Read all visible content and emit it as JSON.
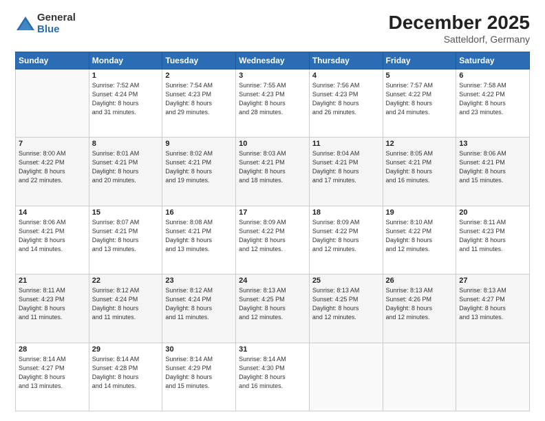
{
  "logo": {
    "general": "General",
    "blue": "Blue"
  },
  "header": {
    "month": "December 2025",
    "location": "Satteldorf, Germany"
  },
  "days_of_week": [
    "Sunday",
    "Monday",
    "Tuesday",
    "Wednesday",
    "Thursday",
    "Friday",
    "Saturday"
  ],
  "weeks": [
    [
      {
        "day": "",
        "info": ""
      },
      {
        "day": "1",
        "info": "Sunrise: 7:52 AM\nSunset: 4:24 PM\nDaylight: 8 hours\nand 31 minutes."
      },
      {
        "day": "2",
        "info": "Sunrise: 7:54 AM\nSunset: 4:23 PM\nDaylight: 8 hours\nand 29 minutes."
      },
      {
        "day": "3",
        "info": "Sunrise: 7:55 AM\nSunset: 4:23 PM\nDaylight: 8 hours\nand 28 minutes."
      },
      {
        "day": "4",
        "info": "Sunrise: 7:56 AM\nSunset: 4:23 PM\nDaylight: 8 hours\nand 26 minutes."
      },
      {
        "day": "5",
        "info": "Sunrise: 7:57 AM\nSunset: 4:22 PM\nDaylight: 8 hours\nand 24 minutes."
      },
      {
        "day": "6",
        "info": "Sunrise: 7:58 AM\nSunset: 4:22 PM\nDaylight: 8 hours\nand 23 minutes."
      }
    ],
    [
      {
        "day": "7",
        "info": "Sunrise: 8:00 AM\nSunset: 4:22 PM\nDaylight: 8 hours\nand 22 minutes."
      },
      {
        "day": "8",
        "info": "Sunrise: 8:01 AM\nSunset: 4:21 PM\nDaylight: 8 hours\nand 20 minutes."
      },
      {
        "day": "9",
        "info": "Sunrise: 8:02 AM\nSunset: 4:21 PM\nDaylight: 8 hours\nand 19 minutes."
      },
      {
        "day": "10",
        "info": "Sunrise: 8:03 AM\nSunset: 4:21 PM\nDaylight: 8 hours\nand 18 minutes."
      },
      {
        "day": "11",
        "info": "Sunrise: 8:04 AM\nSunset: 4:21 PM\nDaylight: 8 hours\nand 17 minutes."
      },
      {
        "day": "12",
        "info": "Sunrise: 8:05 AM\nSunset: 4:21 PM\nDaylight: 8 hours\nand 16 minutes."
      },
      {
        "day": "13",
        "info": "Sunrise: 8:06 AM\nSunset: 4:21 PM\nDaylight: 8 hours\nand 15 minutes."
      }
    ],
    [
      {
        "day": "14",
        "info": "Sunrise: 8:06 AM\nSunset: 4:21 PM\nDaylight: 8 hours\nand 14 minutes."
      },
      {
        "day": "15",
        "info": "Sunrise: 8:07 AM\nSunset: 4:21 PM\nDaylight: 8 hours\nand 13 minutes."
      },
      {
        "day": "16",
        "info": "Sunrise: 8:08 AM\nSunset: 4:21 PM\nDaylight: 8 hours\nand 13 minutes."
      },
      {
        "day": "17",
        "info": "Sunrise: 8:09 AM\nSunset: 4:22 PM\nDaylight: 8 hours\nand 12 minutes."
      },
      {
        "day": "18",
        "info": "Sunrise: 8:09 AM\nSunset: 4:22 PM\nDaylight: 8 hours\nand 12 minutes."
      },
      {
        "day": "19",
        "info": "Sunrise: 8:10 AM\nSunset: 4:22 PM\nDaylight: 8 hours\nand 12 minutes."
      },
      {
        "day": "20",
        "info": "Sunrise: 8:11 AM\nSunset: 4:23 PM\nDaylight: 8 hours\nand 11 minutes."
      }
    ],
    [
      {
        "day": "21",
        "info": "Sunrise: 8:11 AM\nSunset: 4:23 PM\nDaylight: 8 hours\nand 11 minutes."
      },
      {
        "day": "22",
        "info": "Sunrise: 8:12 AM\nSunset: 4:24 PM\nDaylight: 8 hours\nand 11 minutes."
      },
      {
        "day": "23",
        "info": "Sunrise: 8:12 AM\nSunset: 4:24 PM\nDaylight: 8 hours\nand 11 minutes."
      },
      {
        "day": "24",
        "info": "Sunrise: 8:13 AM\nSunset: 4:25 PM\nDaylight: 8 hours\nand 12 minutes."
      },
      {
        "day": "25",
        "info": "Sunrise: 8:13 AM\nSunset: 4:25 PM\nDaylight: 8 hours\nand 12 minutes."
      },
      {
        "day": "26",
        "info": "Sunrise: 8:13 AM\nSunset: 4:26 PM\nDaylight: 8 hours\nand 12 minutes."
      },
      {
        "day": "27",
        "info": "Sunrise: 8:13 AM\nSunset: 4:27 PM\nDaylight: 8 hours\nand 13 minutes."
      }
    ],
    [
      {
        "day": "28",
        "info": "Sunrise: 8:14 AM\nSunset: 4:27 PM\nDaylight: 8 hours\nand 13 minutes."
      },
      {
        "day": "29",
        "info": "Sunrise: 8:14 AM\nSunset: 4:28 PM\nDaylight: 8 hours\nand 14 minutes."
      },
      {
        "day": "30",
        "info": "Sunrise: 8:14 AM\nSunset: 4:29 PM\nDaylight: 8 hours\nand 15 minutes."
      },
      {
        "day": "31",
        "info": "Sunrise: 8:14 AM\nSunset: 4:30 PM\nDaylight: 8 hours\nand 16 minutes."
      },
      {
        "day": "",
        "info": ""
      },
      {
        "day": "",
        "info": ""
      },
      {
        "day": "",
        "info": ""
      }
    ]
  ]
}
